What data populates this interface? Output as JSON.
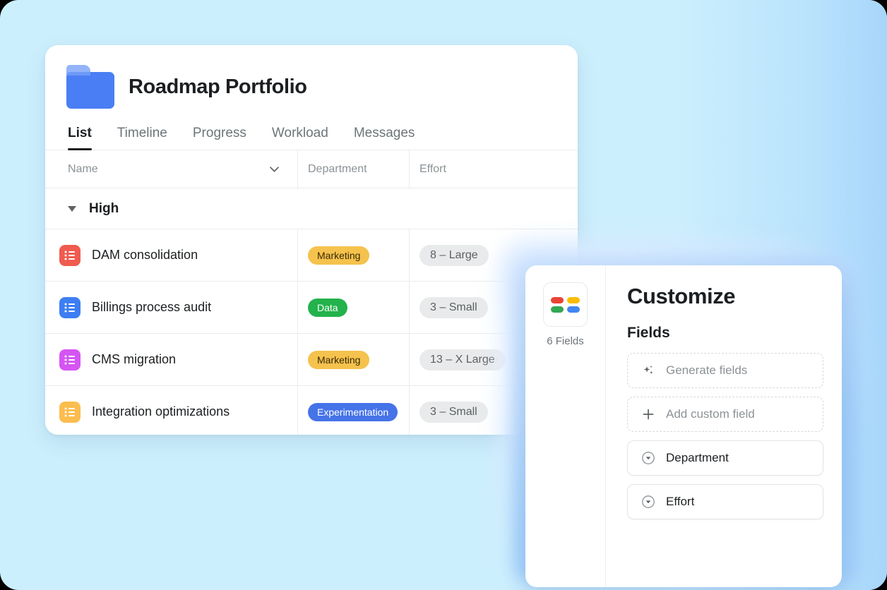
{
  "theme": {
    "page_background": "#cceffd",
    "card_background": "#ffffff",
    "accent_blue": "#4a7ef5",
    "text_primary": "#1c1f21",
    "text_muted": "#8c9296",
    "border": "#eaeced"
  },
  "list_card": {
    "folder_icon": "folder-icon",
    "title": "Roadmap Portfolio",
    "tabs": [
      {
        "label": "List",
        "active": true
      },
      {
        "label": "Timeline",
        "active": false
      },
      {
        "label": "Progress",
        "active": false
      },
      {
        "label": "Workload",
        "active": false
      },
      {
        "label": "Messages",
        "active": false
      }
    ],
    "columns": [
      {
        "label": "Name",
        "icon": "chevron-down-icon"
      },
      {
        "label": "Department"
      },
      {
        "label": "Effort"
      }
    ],
    "group": {
      "label": "High",
      "expanded": true,
      "toggle_icon": "triangle-down-icon"
    },
    "rows": [
      {
        "name": "DAM consolidation",
        "icon_color": "#f05b4f",
        "department": {
          "label": "Marketing",
          "bg": "#f5c24d",
          "fg": "#3b2a06"
        },
        "effort": "8 – Large"
      },
      {
        "name": "Billings process audit",
        "icon_color": "#3d7ef2",
        "department": {
          "label": "Data",
          "bg": "#23b24b",
          "fg": "#ffffff"
        },
        "effort": "3 – Small"
      },
      {
        "name": "CMS migration",
        "icon_color": "#d455f2",
        "department": {
          "label": "Marketing",
          "bg": "#f5c24d",
          "fg": "#3b2a06"
        },
        "effort": "13 – X Large"
      },
      {
        "name": "Integration optimizations",
        "icon_color": "#fbbd4e",
        "department": {
          "label": "Experimentation",
          "bg": "#4573e8",
          "fg": "#ffffff"
        },
        "effort": "3 – Small"
      }
    ]
  },
  "customize_panel": {
    "aside": {
      "tile_icon": "fields-grid-icon",
      "tile_colors": [
        "#ea4335",
        "#fbbc05",
        "#34a853",
        "#4285f4"
      ],
      "count_label": "6 Fields"
    },
    "title": "Customize",
    "section_title": "Fields",
    "fields": [
      {
        "label": "Generate fields",
        "icon": "sparkle-icon",
        "style": "dashed"
      },
      {
        "label": "Add custom field",
        "icon": "plus-icon",
        "style": "dashed"
      },
      {
        "label": "Department",
        "icon": "circle-chevron-down-icon",
        "style": "solid"
      },
      {
        "label": "Effort",
        "icon": "circle-chevron-down-icon",
        "style": "solid"
      }
    ]
  }
}
